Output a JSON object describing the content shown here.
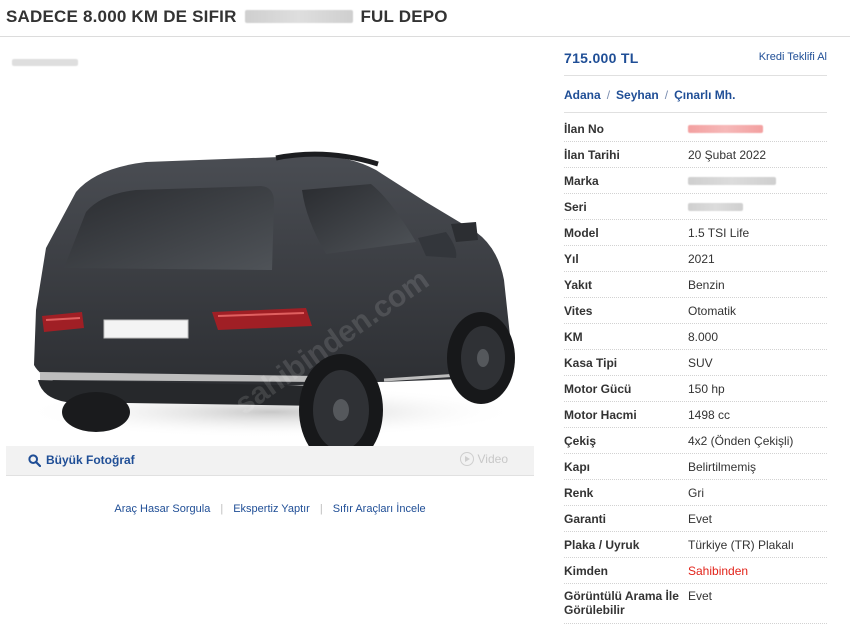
{
  "listing": {
    "title_start": "SADECE 8.000 KM DE SIFIR",
    "title_end": "FUL DEPO"
  },
  "photo": {
    "big_photo_label": "Büyük Fotoğraf",
    "video_label": "Video"
  },
  "links": [
    "Araç Hasar Sorgula",
    "Ekspertiz Yaptır",
    "Sıfır Araçları İncele"
  ],
  "price": "715.000 TL",
  "credit_label": "Kredi Teklifi Al",
  "location": [
    "Adana",
    "Seyhan",
    "Çınarlı Mh."
  ],
  "details": [
    {
      "label": "İlan No",
      "value": ""
    },
    {
      "label": "İlan Tarihi",
      "value": "20 Şubat 2022"
    },
    {
      "label": "Marka",
      "value": ""
    },
    {
      "label": "Seri",
      "value": ""
    },
    {
      "label": "Model",
      "value": "1.5 TSI Life"
    },
    {
      "label": "Yıl",
      "value": "2021"
    },
    {
      "label": "Yakıt",
      "value": "Benzin"
    },
    {
      "label": "Vites",
      "value": "Otomatik"
    },
    {
      "label": "KM",
      "value": "8.000"
    },
    {
      "label": "Kasa Tipi",
      "value": "SUV"
    },
    {
      "label": "Motor Gücü",
      "value": "150 hp"
    },
    {
      "label": "Motor Hacmi",
      "value": "1498 cc"
    },
    {
      "label": "Çekiş",
      "value": "4x2 (Önden Çekişli)"
    },
    {
      "label": "Kapı",
      "value": "Belirtilmemiş"
    },
    {
      "label": "Renk",
      "value": "Gri"
    },
    {
      "label": "Garanti",
      "value": "Evet"
    },
    {
      "label": "Plaka / Uyruk",
      "value": "Türkiye (TR) Plakalı"
    },
    {
      "label": "Kimden",
      "value": "Sahibinden"
    },
    {
      "label": "Görüntülü Arama İle Görülebilir",
      "value": "Evet"
    }
  ],
  "colors": {
    "link_blue": "#1f4e96",
    "seller_red": "#e2231a",
    "car_body": "#3a3d42"
  },
  "icons": {
    "search": "magnifier-icon",
    "video": "play-circle-icon"
  }
}
